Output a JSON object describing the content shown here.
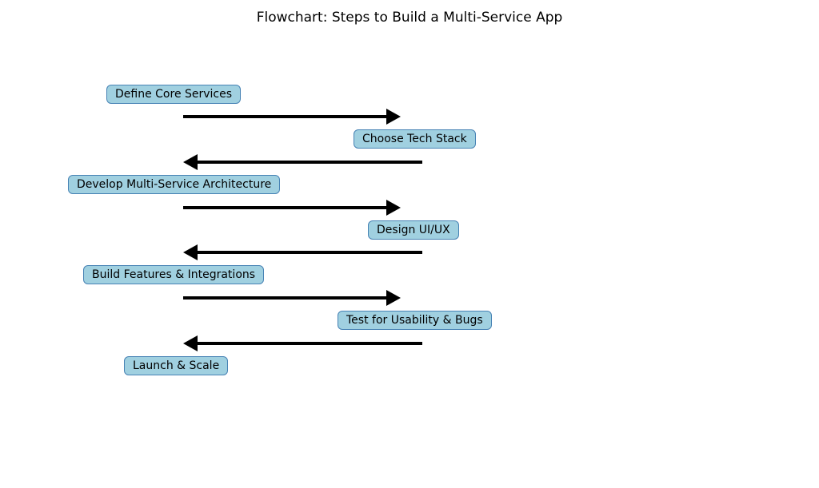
{
  "title": "Flowchart: Steps to Build a Multi-Service App",
  "nodes": {
    "n1": "Define Core Services",
    "n2": "Choose Tech Stack",
    "n3": "Develop Multi-Service Architecture",
    "n4": "Design UI/UX",
    "n5": "Build Features & Integrations",
    "n6": "Test for Usability & Bugs",
    "n7": "Launch & Scale"
  }
}
